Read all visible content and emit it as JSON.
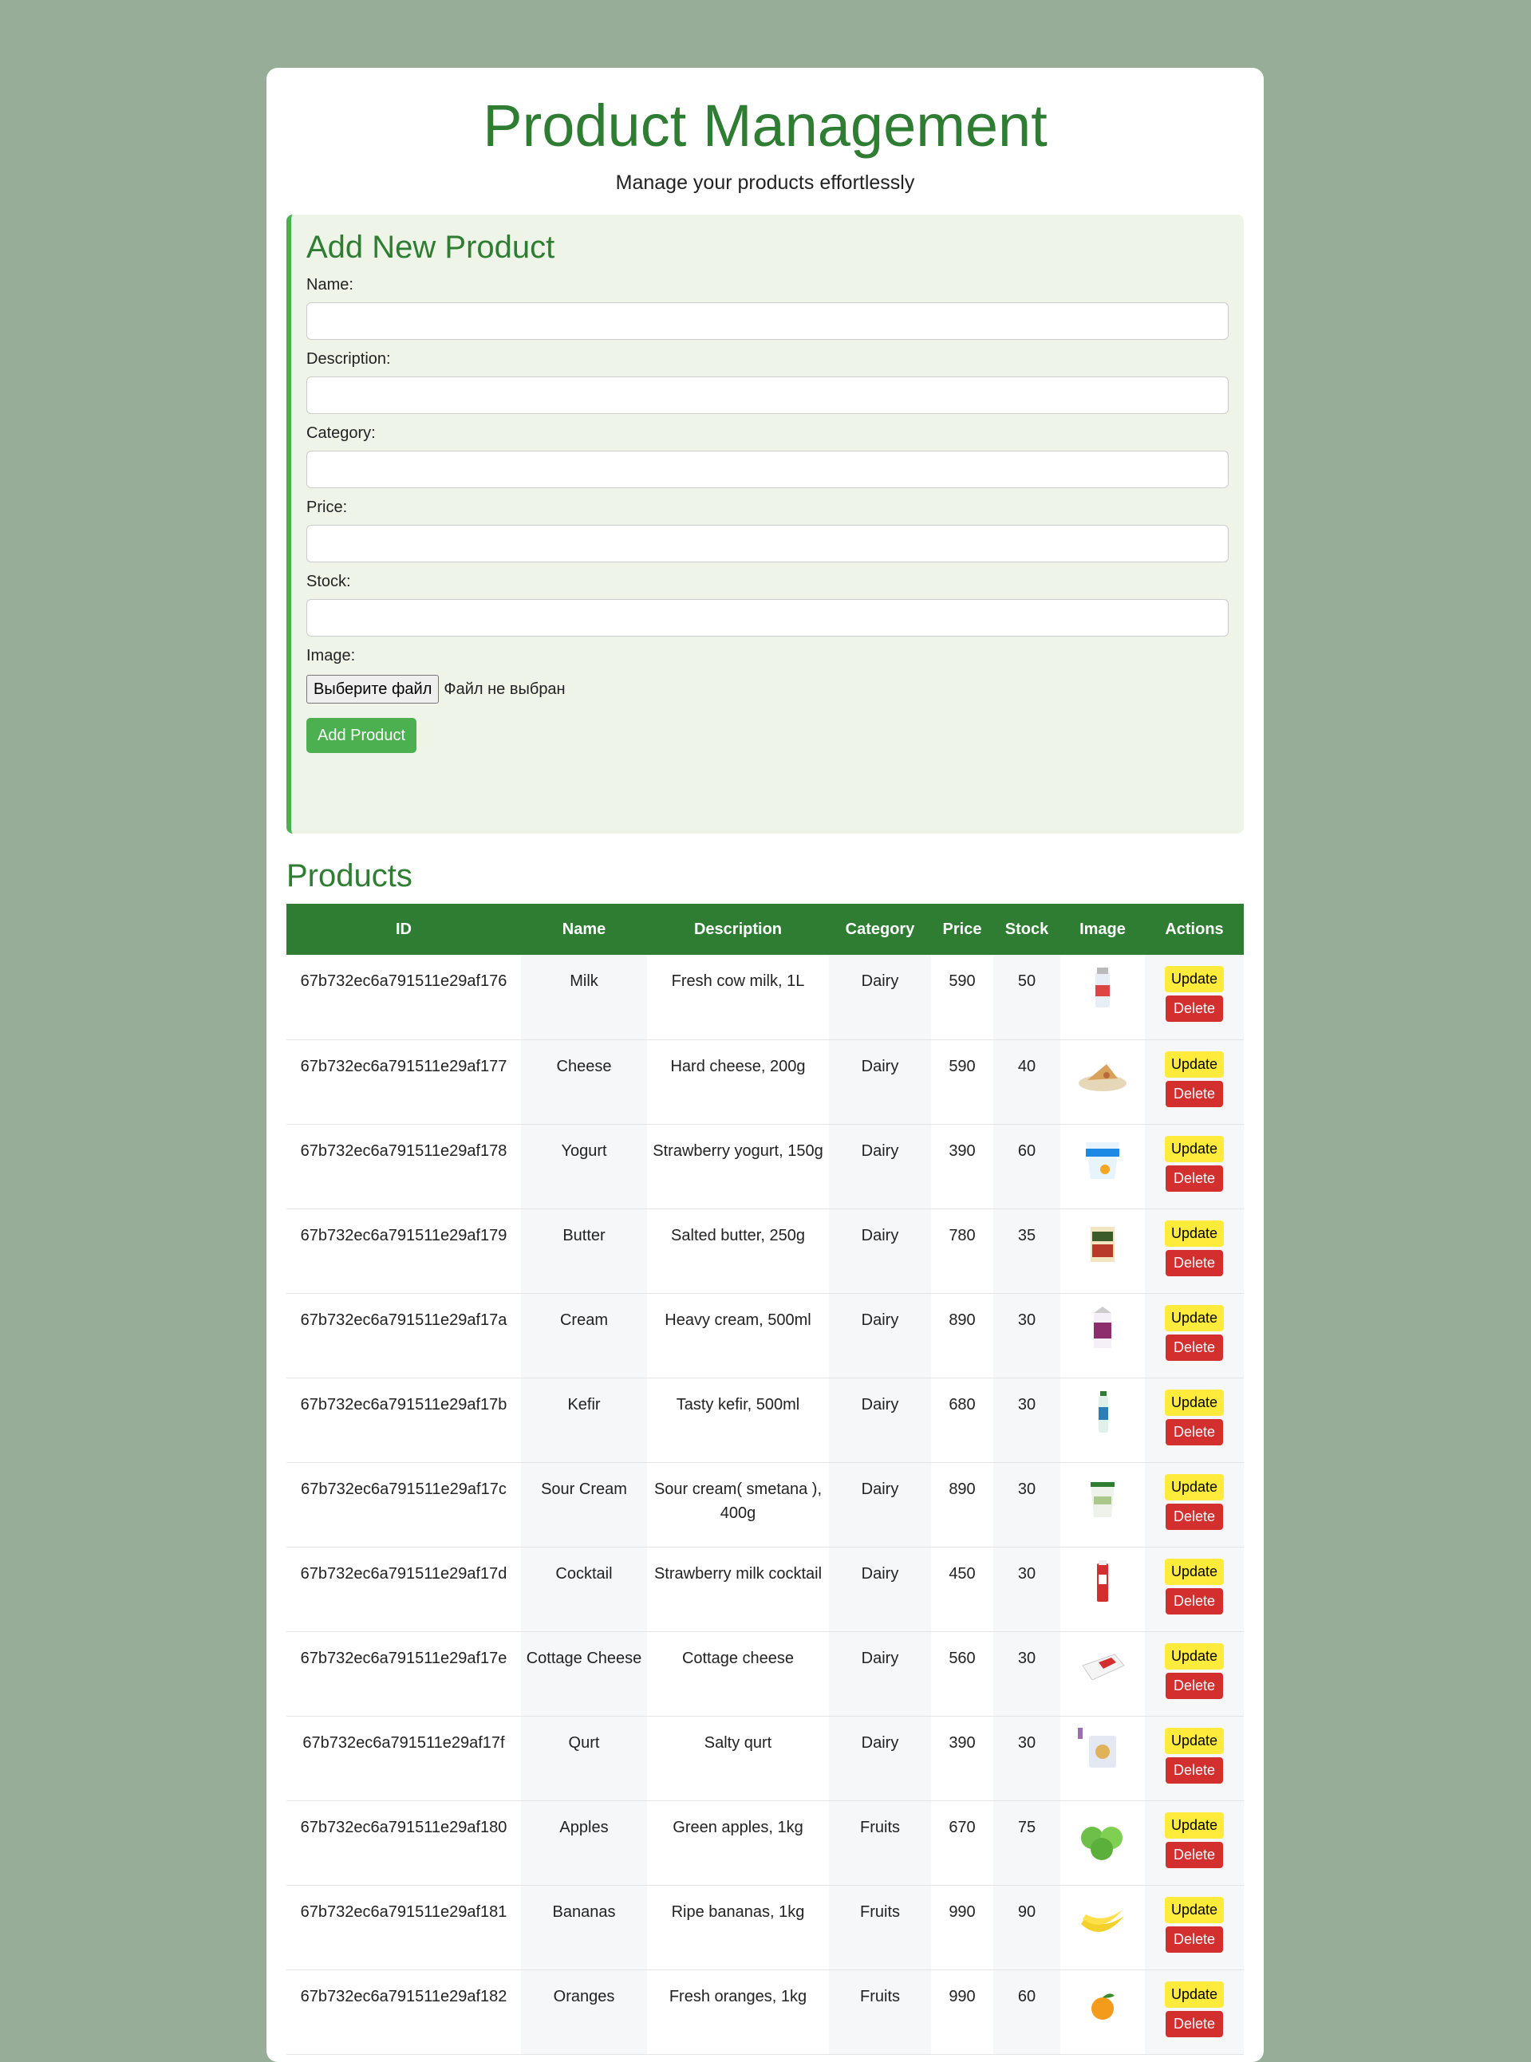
{
  "header": {
    "title": "Product Management",
    "subtitle": "Manage your products effortlessly"
  },
  "form": {
    "heading": "Add New Product",
    "name_label": "Name:",
    "description_label": "Description:",
    "category_label": "Category:",
    "price_label": "Price:",
    "stock_label": "Stock:",
    "image_label": "Image:",
    "file_button": "Выберите файл",
    "file_status": "Файл не выбран",
    "submit_label": "Add Product"
  },
  "products": {
    "heading": "Products",
    "columns": [
      "ID",
      "Name",
      "Description",
      "Category",
      "Price",
      "Stock",
      "Image",
      "Actions"
    ],
    "update_label": "Update",
    "delete_label": "Delete",
    "rows": [
      {
        "id": "67b732ec6a791511e29af176",
        "name": "Milk",
        "description": "Fresh cow milk, 1L",
        "category": "Dairy",
        "price": "590",
        "stock": "50",
        "image": "milk-carton-icon"
      },
      {
        "id": "67b732ec6a791511e29af177",
        "name": "Cheese",
        "description": "Hard cheese, 200g",
        "category": "Dairy",
        "price": "590",
        "stock": "40",
        "image": "cheese-plate-icon"
      },
      {
        "id": "67b732ec6a791511e29af178",
        "name": "Yogurt",
        "description": "Strawberry yogurt, 150g",
        "category": "Dairy",
        "price": "390",
        "stock": "60",
        "image": "yogurt-cup-icon"
      },
      {
        "id": "67b732ec6a791511e29af179",
        "name": "Butter",
        "description": "Salted butter, 250g",
        "category": "Dairy",
        "price": "780",
        "stock": "35",
        "image": "butter-pack-icon"
      },
      {
        "id": "67b732ec6a791511e29af17a",
        "name": "Cream",
        "description": "Heavy cream, 500ml",
        "category": "Dairy",
        "price": "890",
        "stock": "30",
        "image": "cream-carton-icon"
      },
      {
        "id": "67b732ec6a791511e29af17b",
        "name": "Kefir",
        "description": "Tasty kefir, 500ml",
        "category": "Dairy",
        "price": "680",
        "stock": "30",
        "image": "kefir-bottle-icon"
      },
      {
        "id": "67b732ec6a791511e29af17c",
        "name": "Sour Cream",
        "description": "Sour cream( smetana ), 400g",
        "category": "Dairy",
        "price": "890",
        "stock": "30",
        "image": "sour-cream-cup-icon"
      },
      {
        "id": "67b732ec6a791511e29af17d",
        "name": "Cocktail",
        "description": "Strawberry milk cocktail",
        "category": "Dairy",
        "price": "450",
        "stock": "30",
        "image": "milk-cocktail-icon"
      },
      {
        "id": "67b732ec6a791511e29af17e",
        "name": "Cottage Cheese",
        "description": "Cottage cheese",
        "category": "Dairy",
        "price": "560",
        "stock": "30",
        "image": "cottage-cheese-icon"
      },
      {
        "id": "67b732ec6a791511e29af17f",
        "name": "Qurt",
        "description": "Salty qurt",
        "category": "Dairy",
        "price": "390",
        "stock": "30",
        "image": "qurt-pack-icon"
      },
      {
        "id": "67b732ec6a791511e29af180",
        "name": "Apples",
        "description": "Green apples, 1kg",
        "category": "Fruits",
        "price": "670",
        "stock": "75",
        "image": "green-apples-icon"
      },
      {
        "id": "67b732ec6a791511e29af181",
        "name": "Bananas",
        "description": "Ripe bananas, 1kg",
        "category": "Fruits",
        "price": "990",
        "stock": "90",
        "image": "bananas-icon"
      },
      {
        "id": "67b732ec6a791511e29af182",
        "name": "Oranges",
        "description": "Fresh oranges, 1kg",
        "category": "Fruits",
        "price": "990",
        "stock": "60",
        "image": "orange-icon"
      }
    ]
  },
  "colors": {
    "page_bg": "#98ad98",
    "accent": "#2e7d32",
    "button_green": "#4caf50",
    "update_yellow": "#ffeb3b",
    "delete_red": "#d32f2f"
  }
}
